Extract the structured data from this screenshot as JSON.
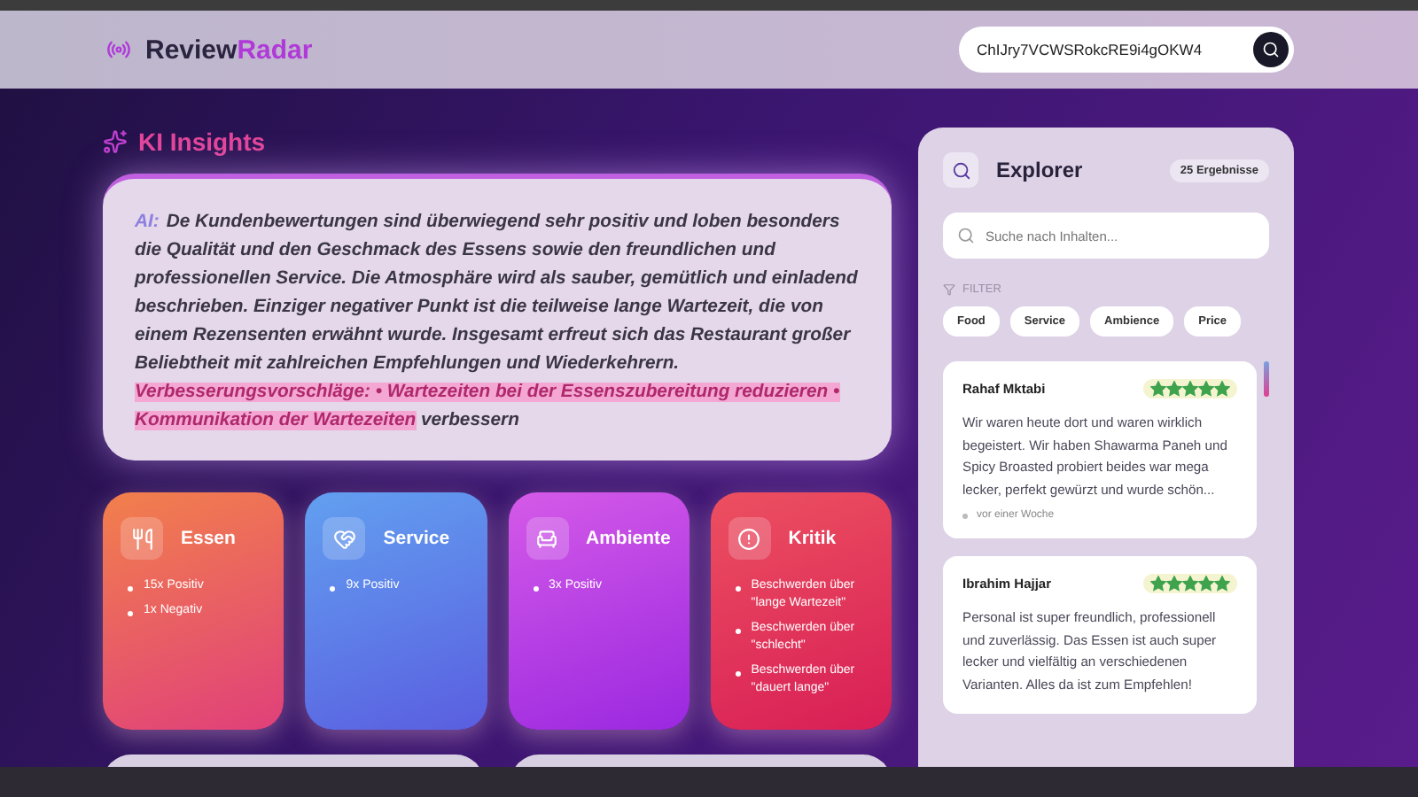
{
  "header": {
    "logo_part1": "Review",
    "logo_part2": "Radar",
    "search_value": "ChIJry7VCWSRokcRE9i4gOKW4"
  },
  "insights": {
    "title": "KI Insights",
    "prefix": "AI:",
    "text": "De Kundenbewertungen sind überwiegend sehr positiv und loben besonders die Qualität und den Geschmack des Essens sowie den freundlichen und professionellen Service. Die Atmosphäre wird als sauber, gemütlich und einladend beschrieben. Einziger negativer Punkt ist die teilweise lange Wartezeit, die von einem Rezensenten erwähnt wurde. Insgesamt erfreut sich das Restaurant großer Beliebtheit mit zahlreichen Empfehlungen und Wiederkehrern.",
    "highlight": "Verbesserungsvorschläge: • Wartezeiten bei der Essenszubereitung reduzieren • Kommunikation der Wartezeiten",
    "tail": "verbessern"
  },
  "categories": [
    {
      "kind": "food",
      "title": "Essen",
      "items": [
        "15x Positiv",
        "1x Negativ"
      ]
    },
    {
      "kind": "service",
      "title": "Service",
      "items": [
        "9x Positiv"
      ]
    },
    {
      "kind": "ambience",
      "title": "Ambiente",
      "items": [
        "3x Positiv"
      ]
    },
    {
      "kind": "critique",
      "title": "Kritik",
      "items": [
        "Beschwerden über \"lange Wartezeit\"",
        "Beschwerden über \"schlecht\"",
        "Beschwerden über \"dauert lange\""
      ]
    }
  ],
  "explorer": {
    "title": "Explorer",
    "count": "25 Ergebnisse",
    "search_placeholder": "Suche nach Inhalten...",
    "filter_label": "FILTER",
    "filters": [
      "Food",
      "Service",
      "Ambience",
      "Price"
    ],
    "reviews": [
      {
        "author": "Rahaf Mktabi",
        "stars": 5,
        "text": "Wir waren heute dort und waren wirklich begeistert. Wir haben Shawarma Paneh und Spicy Broasted probiert beides war mega lecker, perfekt gewürzt und wurde schön...",
        "date": "vor einer Woche"
      },
      {
        "author": "Ibrahim Hajjar",
        "stars": 5,
        "text": "Personal ist super freundlich, professionell und zuverlässig. Das Essen ist auch super lecker und vielfältig an verschiedenen Varianten. Alles da ist zum Empfehlen!"
      }
    ]
  }
}
